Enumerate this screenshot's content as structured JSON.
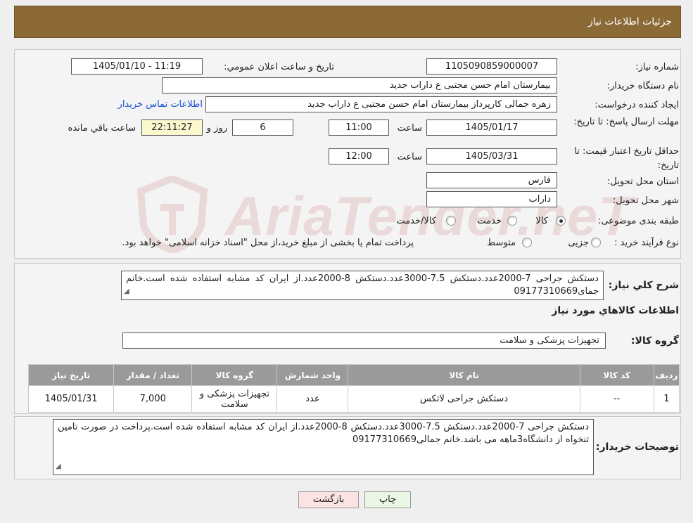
{
  "header": {
    "title": "جزئیات اطلاعات نیاز"
  },
  "form": {
    "need_number": {
      "label": "شماره نیاز:",
      "value": "1105090859000007"
    },
    "announce_datetime": {
      "label": "تاریخ و ساعت اعلان عمومي:",
      "value": "1405/01/10 - 11:19"
    },
    "buyer_org": {
      "label": "نام دستگاه خريدار:",
      "value": "بیمارستان امام حسن مجتبی  ع  داراب جدید"
    },
    "requester": {
      "label": "ايجاد کننده درخواست:",
      "value": "زهره جمالی کارپرداز بیمارستان امام حسن مجتبی  ع  داراب جدید",
      "contact_link": "اطلاعات تماس خريدار"
    },
    "deadline": {
      "label": "مهلت ارسال پاسخ: تا تاریخ:",
      "date": "1405/01/17",
      "time_label": "ساعت",
      "time": "11:00",
      "days": "6",
      "days_label": "روز و",
      "remaining": "22:11:27",
      "remaining_label": "ساعت باقي مانده"
    },
    "price_validity": {
      "label": "حداقل تاریخ اعتبار قیمت: تا تاریخ:",
      "date": "1405/03/31",
      "time_label": "ساعت",
      "time": "12:00"
    },
    "province": {
      "label": "استان محل تحويل:",
      "value": "فارس"
    },
    "city": {
      "label": "شهر محل تحويل:",
      "value": "داراب"
    },
    "category": {
      "label": "طبقه بندی موضوعی:",
      "options": [
        "کالا",
        "خدمت",
        "کالا/خدمت"
      ],
      "selected": "کالا"
    },
    "process": {
      "label": "نوع فرآیند خرید :",
      "options": [
        "جزیی",
        "متوسط"
      ],
      "note": "پرداخت تمام یا بخشی از مبلغ خرید،از محل \"اسناد خزانه اسلامی\" خواهد بود."
    }
  },
  "description": {
    "label": "شرح كلي نياز:",
    "value": "دستکش جراحی 7-2000عدد.دستکش 7.5-3000عدد.دستکش 8-2000عدد.از ایران کد مشابه استفاده شده است.خانم جمای09177310669"
  },
  "items_section": {
    "title": "اطلاعات كالاهاي مورد نياز"
  },
  "goods_group": {
    "label": "گروه كالا:",
    "value": "تجهیزات پزشکی و سلامت"
  },
  "table": {
    "headers": [
      "رديف",
      "كد كالا",
      "نام كالا",
      "واحد شمارش",
      "گروه كالا",
      "تعداد / مقدار",
      "تاريخ نياز"
    ],
    "rows": [
      [
        "1",
        "--",
        "دستکش جراحی لاتکس",
        "عدد",
        "تجهیزات پزشکی و سلامت",
        "7,000",
        "1405/01/31"
      ]
    ]
  },
  "buyer_notes": {
    "label": "توضيحات خريدار:",
    "value": "دستکش جراحی 7-2000عدد.دستکش 7.5-3000عدد.دستکش 8-2000عدد.از ایران کد مشابه استفاده شده است.پرداخت در صورت تامین تنخواه از دانشگاه3ماهه می باشد.خانم جمالی09177310669"
  },
  "buttons": {
    "print": "چاپ",
    "back": "بازگشت"
  },
  "watermark": {
    "text": "AriaTender.neT",
    "color": "#c97b7b"
  }
}
